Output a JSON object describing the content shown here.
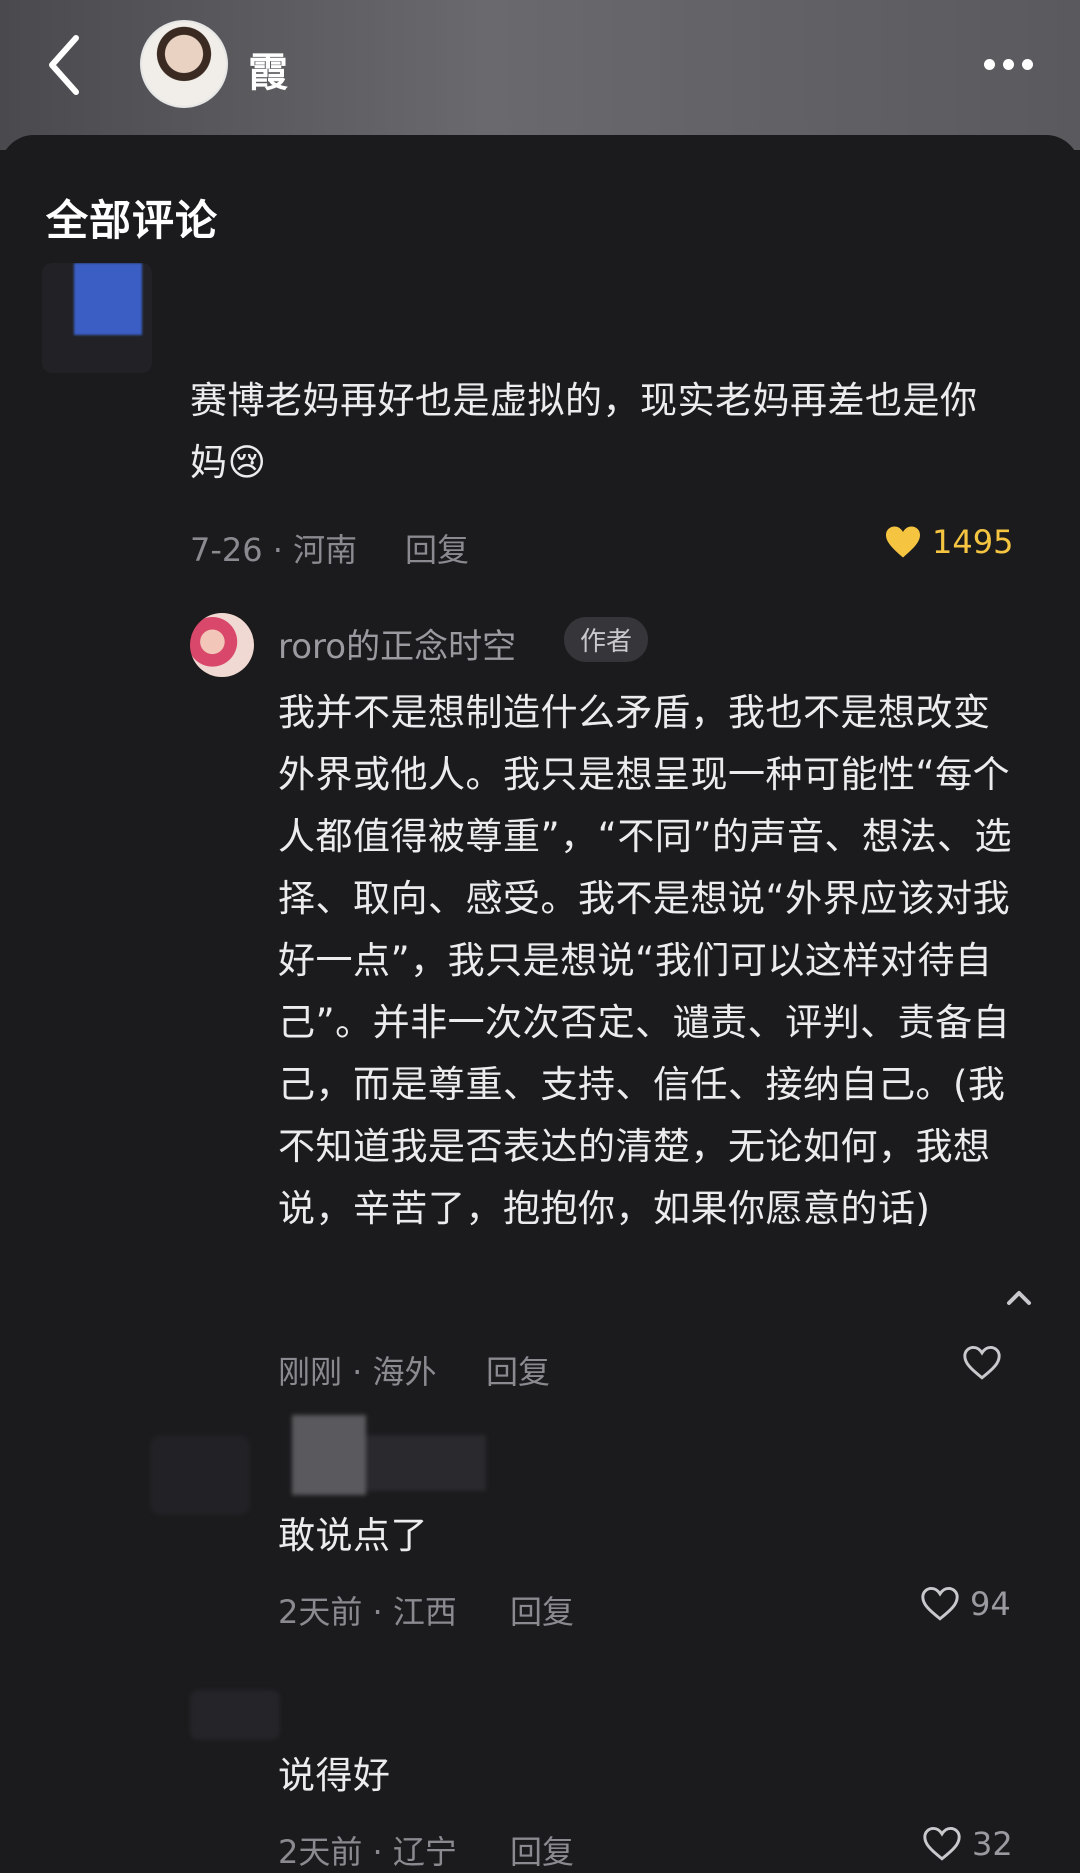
{
  "header": {
    "name": "霞"
  },
  "panel": {
    "title": "全部评论"
  },
  "comments": [
    {
      "text": "赛博老妈再好也是虚拟的，现实老妈再差也是你妈",
      "emoji": "😢",
      "meta": "7-26 · 河南",
      "reply": "回复",
      "likes": "1495"
    },
    {
      "username": "roro的正念时空",
      "tag": "作者",
      "text": "我并不是想制造什么矛盾，我也不是想改变外界或他人。我只是想呈现一种可能性“每个人都值得被尊重”，“不同”的声音、想法、选择、取向、感受。我不是想说“外界应该对我好一点”，我只是想说“我们可以这样对待自己”。并非一次次否定、谴责、评判、责备自己，而是尊重、支持、信任、接纳自己。(我不知道我是否表达的清楚，无论如何，我想说，辛苦了，抱抱你，如果你愿意的话)",
      "meta": "刚刚 · 海外",
      "reply": "回复"
    },
    {
      "text": "敢说点了",
      "meta": "2天前 · 江西",
      "reply": "回复",
      "likes": "94"
    },
    {
      "text": "说得好",
      "meta": "2天前 · 辽宁",
      "reply": "回复",
      "likes": "32"
    }
  ],
  "colors": {
    "accent": "#f5c542",
    "background": "#1b1b1d"
  }
}
